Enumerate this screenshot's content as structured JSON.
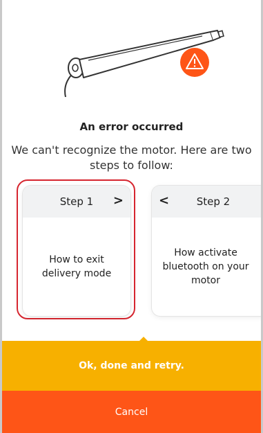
{
  "dialog": {
    "title": "An error occurred",
    "message": "We can't recognize the motor. Here are two steps to follow:"
  },
  "steps": [
    {
      "header": "Step 1",
      "body": "How to exit delivery mode",
      "nav": ">"
    },
    {
      "header": "Step 2",
      "body": "How activate bluetooth on your motor",
      "nav": "<"
    }
  ],
  "actions": {
    "retry_label": "Ok, done and retry.",
    "cancel_label": "Cancel"
  },
  "colors": {
    "accent_primary": "#f7b000",
    "accent_danger": "#fe5517",
    "selection": "#d6252f"
  },
  "icons": {
    "motor": "motor-illustration-icon",
    "warning": "warning-triangle-icon"
  }
}
